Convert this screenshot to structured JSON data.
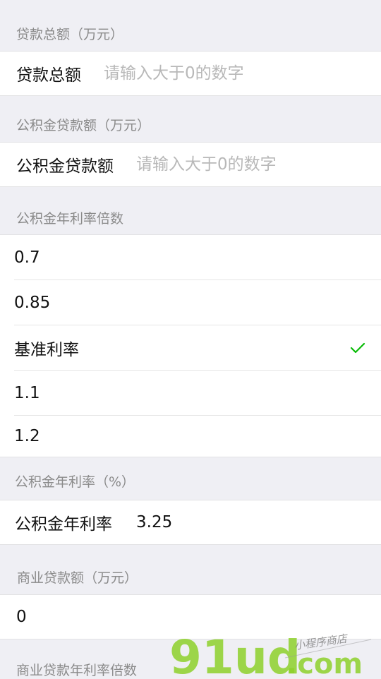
{
  "colors": {
    "background": "#efeff4",
    "card": "#ffffff",
    "header_text": "#8a8a8a",
    "placeholder": "#b8b8b8",
    "check": "#09bb07",
    "watermark_green": "#8ed12c"
  },
  "sections": {
    "loan_total": {
      "header": "贷款总额（万元）",
      "label": "贷款总额",
      "placeholder": "请输入大于0的数字"
    },
    "fund_amount": {
      "header": "公积金贷款额（万元）",
      "label": "公积金贷款额",
      "placeholder": "请输入大于0的数字"
    },
    "fund_rate_multiplier": {
      "header": "公积金年利率倍数",
      "options": [
        "0.7",
        "0.85",
        "基准利率",
        "1.1",
        "1.2"
      ],
      "selected": "基准利率",
      "selected_icon": "check-icon"
    },
    "fund_rate": {
      "header": "公积金年利率（%）",
      "label": "公积金年利率",
      "value": "3.25"
    },
    "commercial_amount": {
      "header": "商业贷款额（万元）",
      "value": "0"
    },
    "commercial_rate_multiplier": {
      "header": "商业贷款年利率倍数"
    }
  },
  "watermark": {
    "brand": "91ud",
    "domain": ".com",
    "tagline": "小程序商店"
  }
}
